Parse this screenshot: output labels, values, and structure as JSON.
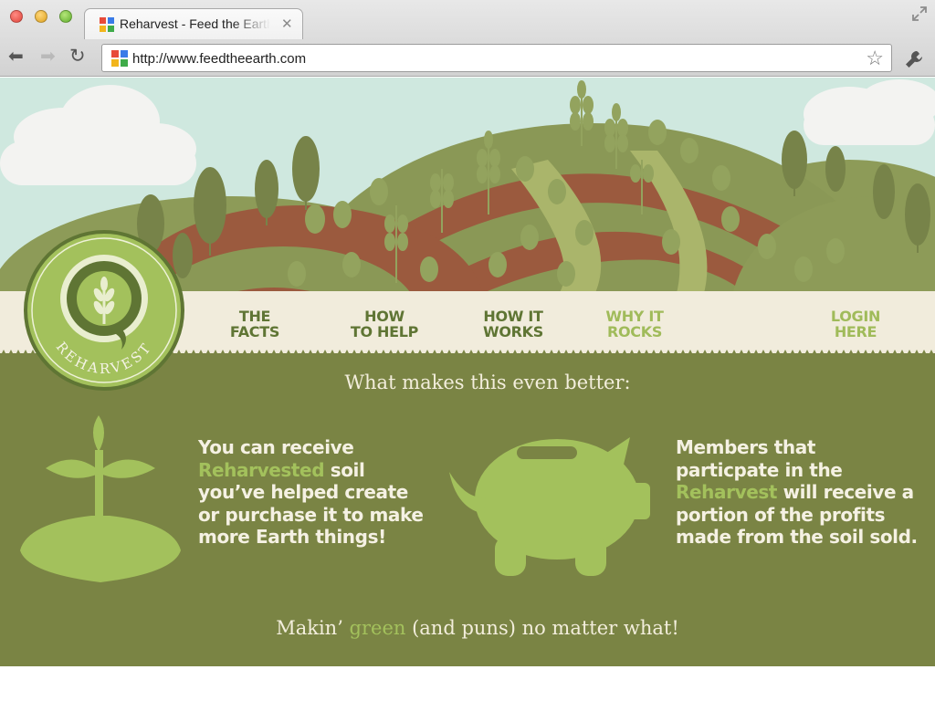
{
  "browser": {
    "tab_title": "Reharvest - Feed the Earth",
    "url": "http://www.feedtheearth.com"
  },
  "site": {
    "logo_text": "REHARVEST",
    "nav": [
      {
        "line1": "THE",
        "line2": "FACTS"
      },
      {
        "line1": "HOW",
        "line2": "TO HELP"
      },
      {
        "line1": "HOW IT",
        "line2": "WORKS"
      },
      {
        "line1": "WHY IT",
        "line2": "ROCKS"
      }
    ],
    "login": {
      "line1": "LOGIN",
      "line2": "HERE"
    },
    "headline": "What makes this even better:",
    "left_blurb": {
      "lead": "You can receive",
      "highlight": "Reharvested",
      "rest": " soil you’ve helped create or purchase it to make more Earth things!"
    },
    "right_blurb": {
      "lead": "Members that particpate in the",
      "highlight": "Reharvest",
      "rest": " will receive a portion of the profits made from the soil sold."
    },
    "footer": {
      "before": "Makin’ ",
      "highlight": "green",
      "after": " (and puns) no matter what!"
    }
  },
  "colors": {
    "sky": "#cfe8df",
    "nav_band": "#f1ecdc",
    "content_bg": "#7a8444",
    "accent_green": "#a3c15c",
    "nav_dark": "#5f7534",
    "field_brown": "#9b5a3e"
  },
  "icons": [
    "back-arrow-icon",
    "forward-arrow-icon",
    "reload-icon",
    "star-icon",
    "wrench-icon",
    "sprout-icon",
    "piggy-bank-icon",
    "wheat-logo-icon"
  ]
}
